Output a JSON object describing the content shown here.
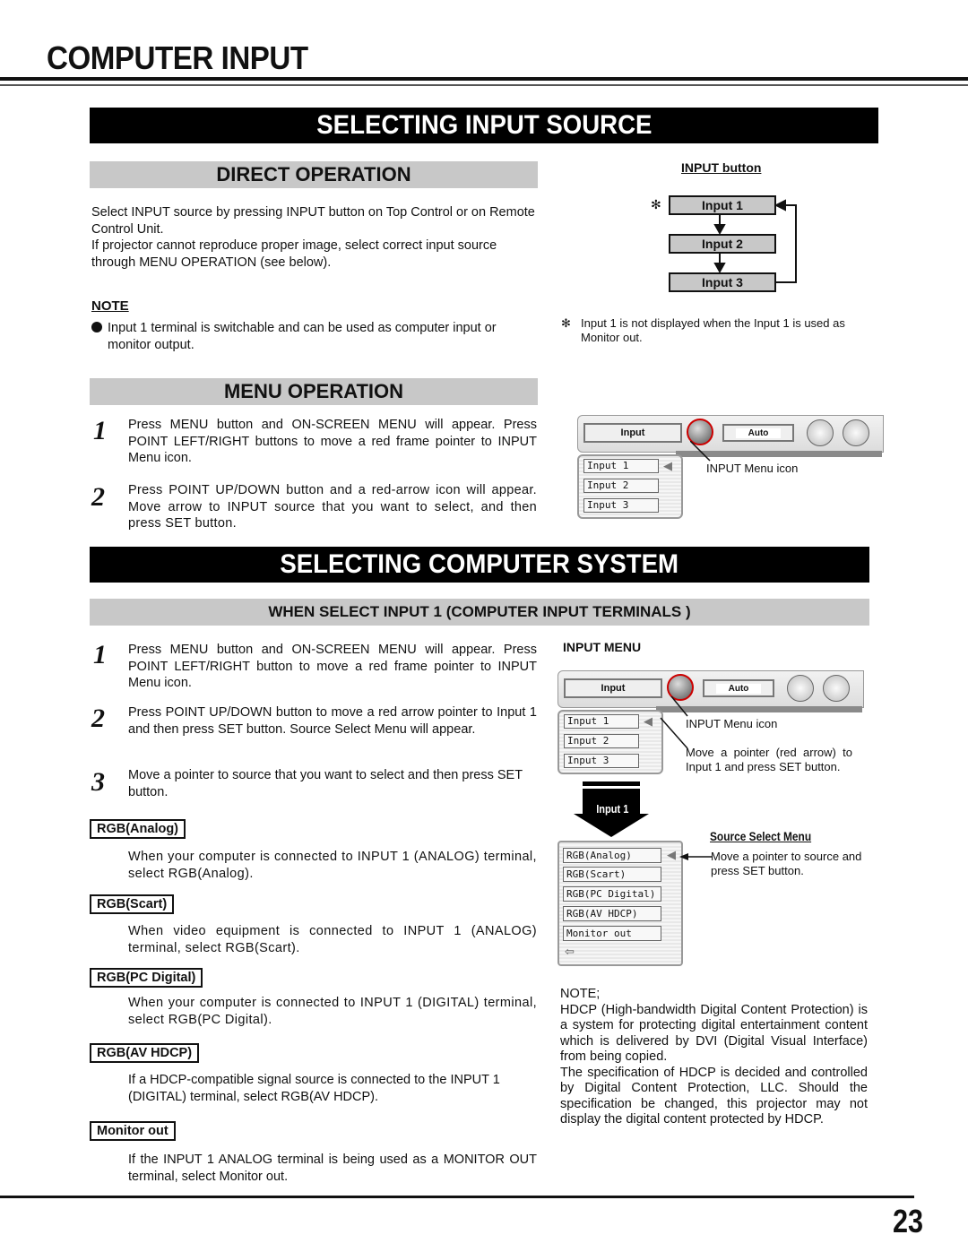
{
  "page": {
    "title": "COMPUTER INPUT",
    "page_number": "23"
  },
  "selecting_input_source": {
    "banner": "SELECTING INPUT SOURCE",
    "direct_operation": {
      "heading": "DIRECT OPERATION",
      "paragraphs": [
        "Select INPUT source by pressing INPUT button on Top Control or on Remote Control Unit.",
        "If projector cannot reproduce proper image, select correct input source through MENU OPERATION (see below)."
      ],
      "note_heading": "NOTE",
      "note_bullet": "Input 1 terminal is switchable and can be used as computer input or monitor output."
    },
    "input_button_diagram": {
      "title": "INPUT button",
      "asterisk": "✻",
      "boxes": [
        "Input 1",
        "Input 2",
        "Input 3"
      ],
      "footnote_mark": "✻",
      "footnote": "Input 1 is not displayed when the Input 1 is used as Monitor out."
    },
    "menu_operation": {
      "heading": "MENU OPERATION",
      "steps": [
        {
          "num": "1",
          "text": "Press MENU button and ON-SCREEN MENU will appear.  Press POINT LEFT/RIGHT buttons to move a red frame pointer to INPUT Menu icon."
        },
        {
          "num": "2",
          "text": "Press POINT UP/DOWN button and a red-arrow icon will appear.  Move arrow to INPUT source that you want to select, and then press SET button."
        }
      ]
    },
    "osd_menu": {
      "title_button": "Input",
      "mode_value": "Auto",
      "items": [
        "Input 1",
        "Input 2",
        "Input 3"
      ],
      "callout": "INPUT Menu icon"
    }
  },
  "selecting_computer_system": {
    "banner": "SELECTING COMPUTER SYSTEM",
    "subheading": "WHEN SELECT  INPUT 1 (COMPUTER INPUT TERMINALS )",
    "steps": [
      {
        "num": "1",
        "text": "Press MENU button and ON-SCREEN MENU will appear.  Press POINT LEFT/RIGHT button to move a red frame pointer to INPUT Menu icon."
      },
      {
        "num": "2",
        "text": "Press POINT UP/DOWN button to move a red arrow pointer to Input 1 and then press SET button.  Source Select Menu will appear."
      },
      {
        "num": "3",
        "text": "Move a pointer to source that you want to select and then press SET button."
      }
    ],
    "sources": [
      {
        "label": "RGB(Analog)",
        "desc": "When your computer is connected to INPUT 1 (ANALOG) terminal, select RGB(Analog)."
      },
      {
        "label": "RGB(Scart)",
        "desc": "When video equipment is connected to INPUT 1 (ANALOG) terminal, select RGB(Scart)."
      },
      {
        "label": "RGB(PC Digital)",
        "desc": "When your computer is connected to INPUT 1 (DIGITAL) terminal, select RGB(PC Digital)."
      },
      {
        "label": "RGB(AV HDCP)",
        "desc": "If a HDCP-compatible signal source is connected to the INPUT 1 (DIGITAL) terminal, select RGB(AV HDCP)."
      },
      {
        "label": "Monitor out",
        "desc": "If the INPUT 1 ANALOG terminal is being used as a MONITOR OUT terminal, select Monitor out."
      }
    ],
    "input_menu": {
      "heading": "INPUT MENU",
      "title_button": "Input",
      "mode_value": "Auto",
      "items": [
        "Input 1",
        "Input 2",
        "Input 3"
      ],
      "callout_icon": "INPUT Menu icon",
      "callout_pointer": "Move a pointer (red arrow) to Input 1 and press SET button.",
      "arrow_label": "Input 1"
    },
    "source_select_menu": {
      "title": "Source Select Menu",
      "items": [
        "RGB(Analog)",
        "RGB(Scart)",
        "RGB(PC Digital)",
        "RGB(AV HDCP)",
        "Monitor out"
      ],
      "callout": "Move a pointer to source and press SET button."
    },
    "hdcp_note": {
      "heading": "NOTE;",
      "paragraphs": [
        "HDCP (High-bandwidth Digital Content Protection) is a system for protecting digital entertainment content which is delivered by DVI (Digital Visual Interface) from being copied.",
        "The specification of HDCP is decided and controlled by Digital Content Protection, LLC. Should the specification be changed, this projector may not display the digital content protected by HDCP."
      ]
    }
  }
}
